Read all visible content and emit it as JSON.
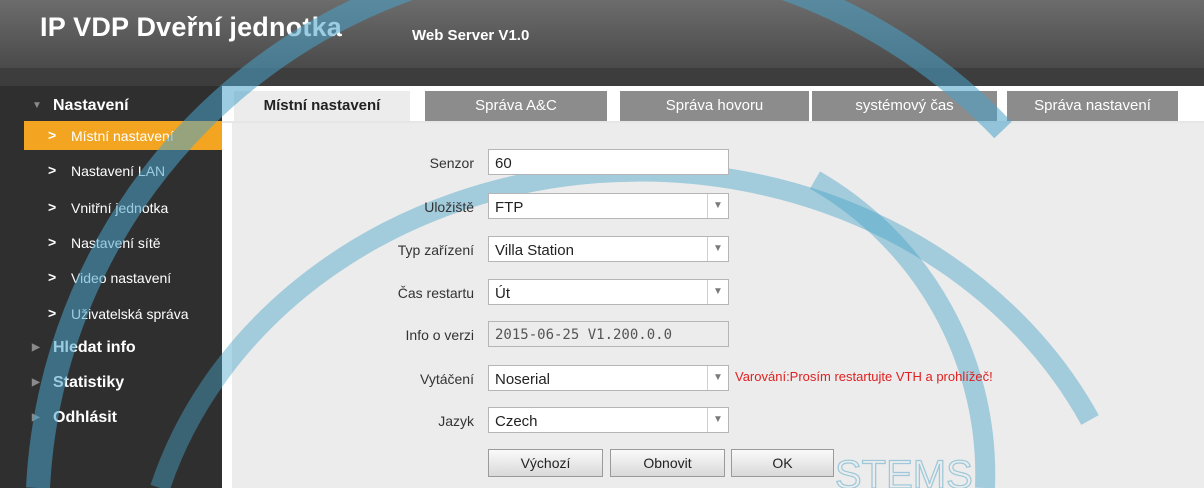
{
  "header": {
    "title": "IP VDP Dveřní jednotka",
    "version": "Web Server V1.0"
  },
  "sidebar": {
    "sections": [
      {
        "label": "Nastavení",
        "items": [
          {
            "label": "Místní nastavení",
            "active": true
          },
          {
            "label": "Nastavení LAN"
          },
          {
            "label": "Vnitřní jednotka"
          },
          {
            "label": "Nastavení sítě"
          },
          {
            "label": "Video nastavení"
          },
          {
            "label": "Uživatelská správa"
          }
        ]
      },
      {
        "label": "Hledat info"
      },
      {
        "label": "Statistiky"
      },
      {
        "label": "Odhlásit"
      }
    ],
    "arrow": ">"
  },
  "tabs": [
    {
      "label": "Místní nastavení",
      "active": true
    },
    {
      "label": "Správa A&C"
    },
    {
      "label": "Správa hovoru"
    },
    {
      "label": "systémový čas"
    },
    {
      "label": "Správa nastavení"
    }
  ],
  "form": {
    "senzor": {
      "label": "Senzor",
      "value": "60"
    },
    "ulozis": {
      "label": "Uložiště",
      "value": "FTP"
    },
    "typ": {
      "label": "Typ zařízení",
      "value": "Villa Station"
    },
    "cas": {
      "label": "Čas restartu",
      "value": "Út"
    },
    "info": {
      "label": "Info o verzi",
      "value": "2015-06-25 V1.200.0.0"
    },
    "vytaceni": {
      "label": "Vytáčení",
      "value": "Noserial",
      "warning": "Varování:Prosím restartujte VTH a prohlížeč!"
    },
    "jazyk": {
      "label": "Jazyk",
      "value": "Czech"
    }
  },
  "buttons": {
    "default": "Výchozí",
    "refresh": "Obnovit",
    "ok": "OK"
  },
  "colors": {
    "accent": "#f3a521",
    "sidebar_bg": "#2f2f2f",
    "warning": "#e02020",
    "watermark": "#4aa3c8"
  },
  "watermark_text": "STEMS"
}
